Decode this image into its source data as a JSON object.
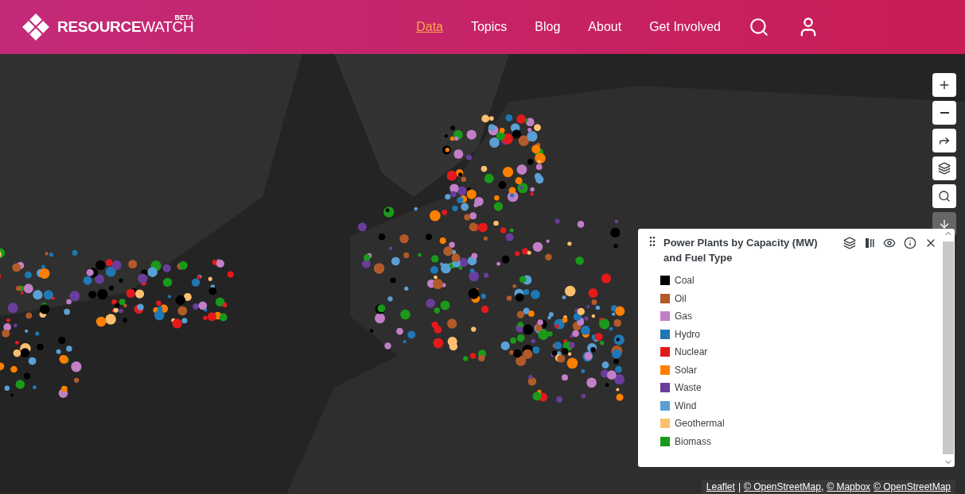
{
  "header": {
    "logo_text_bold": "RESOURCE",
    "logo_text_light": "WATCH",
    "badge": "BETA",
    "nav": [
      {
        "label": "Data",
        "selected": true
      },
      {
        "label": "Topics",
        "selected": false
      },
      {
        "label": "Blog",
        "selected": false
      },
      {
        "label": "About",
        "selected": false
      },
      {
        "label": "Get Involved",
        "selected": false
      }
    ]
  },
  "map_controls": [
    {
      "kind": "zoom-in"
    },
    {
      "kind": "zoom-out"
    },
    {
      "kind": "share"
    },
    {
      "kind": "layers"
    },
    {
      "kind": "search"
    },
    {
      "kind": "collapse"
    }
  ],
  "legend": {
    "title": "Power Plants by Capacity (MW) and Fuel Type",
    "items": [
      {
        "label": "Coal",
        "color": "#000000"
      },
      {
        "label": "Oil",
        "color": "#b35a2a"
      },
      {
        "label": "Gas",
        "color": "#c17fc7"
      },
      {
        "label": "Hydro",
        "color": "#1f78b4"
      },
      {
        "label": "Nuclear",
        "color": "#e31a1c"
      },
      {
        "label": "Solar",
        "color": "#ff7f00"
      },
      {
        "label": "Waste",
        "color": "#6a3d9a"
      },
      {
        "label": "Wind",
        "color": "#5aa0d4"
      },
      {
        "label": "Geothermal",
        "color": "#fdbf6f"
      },
      {
        "label": "Biomass",
        "color": "#1a9a1a"
      }
    ]
  },
  "attribution": [
    {
      "kind": "link",
      "label": "Leaflet"
    },
    {
      "kind": "text",
      "label": "|"
    },
    {
      "kind": "link",
      "label": "© OpenStreetMap,"
    },
    {
      "kind": "link",
      "label": "© Mapbox"
    },
    {
      "kind": "link",
      "label": "© OpenStreetMap"
    }
  ]
}
